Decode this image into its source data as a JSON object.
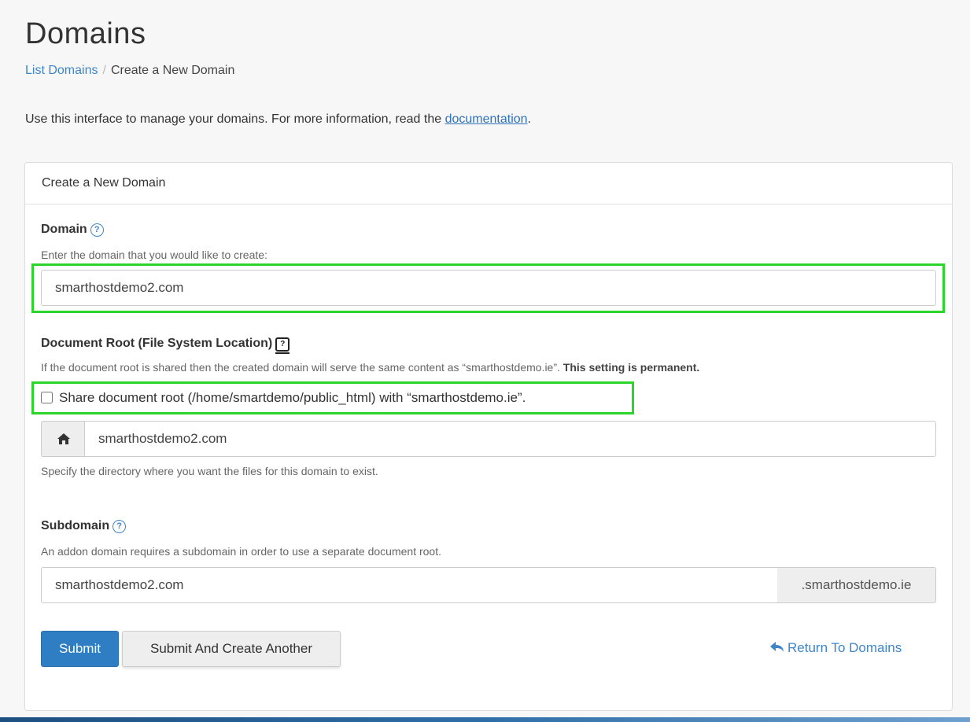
{
  "page": {
    "title": "Domains",
    "breadcrumb": {
      "link": "List Domains",
      "separator": "/",
      "current": "Create a New Domain"
    },
    "intro": {
      "before": "Use this interface to manage your domains. For more information, read the ",
      "link": "documentation",
      "after": "."
    }
  },
  "panel": {
    "heading": "Create a New Domain",
    "domain": {
      "label": "Domain",
      "hint": "Enter the domain that you would like to create:",
      "value": "smarthostdemo2.com"
    },
    "document_root": {
      "label": "Document Root (File System Location)",
      "hint": "If the document root is shared then the created domain will serve the same content as “smarthostdemo.ie”. ",
      "hint_bold": "This setting is permanent.",
      "share_checkbox_label": "Share document root (/home/smartdemo/public_html) with “smarthostdemo.ie”.",
      "share_checked": false,
      "value": "smarthostdemo2.com",
      "help": "Specify the directory where you want the files for this domain to exist."
    },
    "subdomain": {
      "label": "Subdomain",
      "hint": "An addon domain requires a subdomain in order to use a separate document root.",
      "value": "smarthostdemo2.com",
      "suffix": ".smarthostdemo.ie"
    },
    "buttons": {
      "submit": "Submit",
      "submit_another": "Submit And Create Another",
      "return": "Return To Domains"
    }
  },
  "colors": {
    "primary": "#2f7ec4",
    "link": "#3f86c8",
    "highlight": "#2bd52b"
  }
}
